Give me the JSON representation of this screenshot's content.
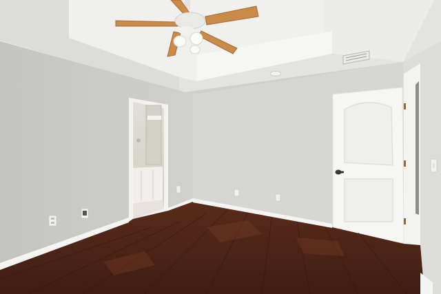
{
  "scene": {
    "kind": "empty bedroom with tray ceiling, ceiling fan, hardwood floor and open door to a bathroom",
    "colors": {
      "ceiling": "#e6e6e3",
      "ceiling_tray": "#eeeeeb",
      "wall_left": "#c9c9c6",
      "wall_back": "#d6d6d3",
      "wall_right": "#dcdcd9",
      "baseboard": "#f4f4f2",
      "floor": "#4a2417",
      "floor_highlight": "#7a3f2a",
      "door": "#f5f5f3",
      "door_panel": "#eeeeec",
      "fan_blade": "#c98a4a",
      "fan_body": "#e9e9e6",
      "bathroom_wall": "#dad7d0",
      "bathroom_cabinet": "#f0efec"
    }
  },
  "icons": {
    "fan": "ceiling-fan-icon",
    "door_knob": "door-knob-icon",
    "switch": "light-switch-icon",
    "outlet": "power-outlet-icon",
    "vent": "air-vent-icon"
  }
}
